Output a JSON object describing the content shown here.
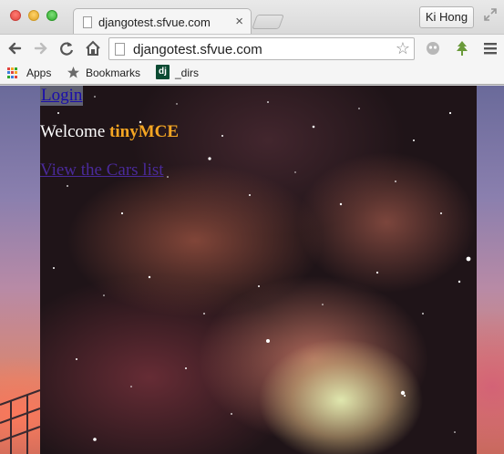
{
  "browser": {
    "tab_title": "djangotest.sfvue.com",
    "tab_close": "×",
    "profile_name": "Ki Hong",
    "url": "djangotest.sfvue.com",
    "star": "☆"
  },
  "bookmarks": {
    "apps_label": "Apps",
    "bookmarks_label": "Bookmarks",
    "dj_badge": "dj",
    "dirs_label": "_dirs"
  },
  "page": {
    "login_link": "Login",
    "welcome_prefix": "Welcome ",
    "welcome_name": "tinyMCE",
    "cars_link": "View the Cars list"
  },
  "colors": {
    "link": "#1a0dab",
    "visited_link": "#4a2a9a",
    "username": "#f5a623",
    "welcome_text": "#ffffff"
  }
}
